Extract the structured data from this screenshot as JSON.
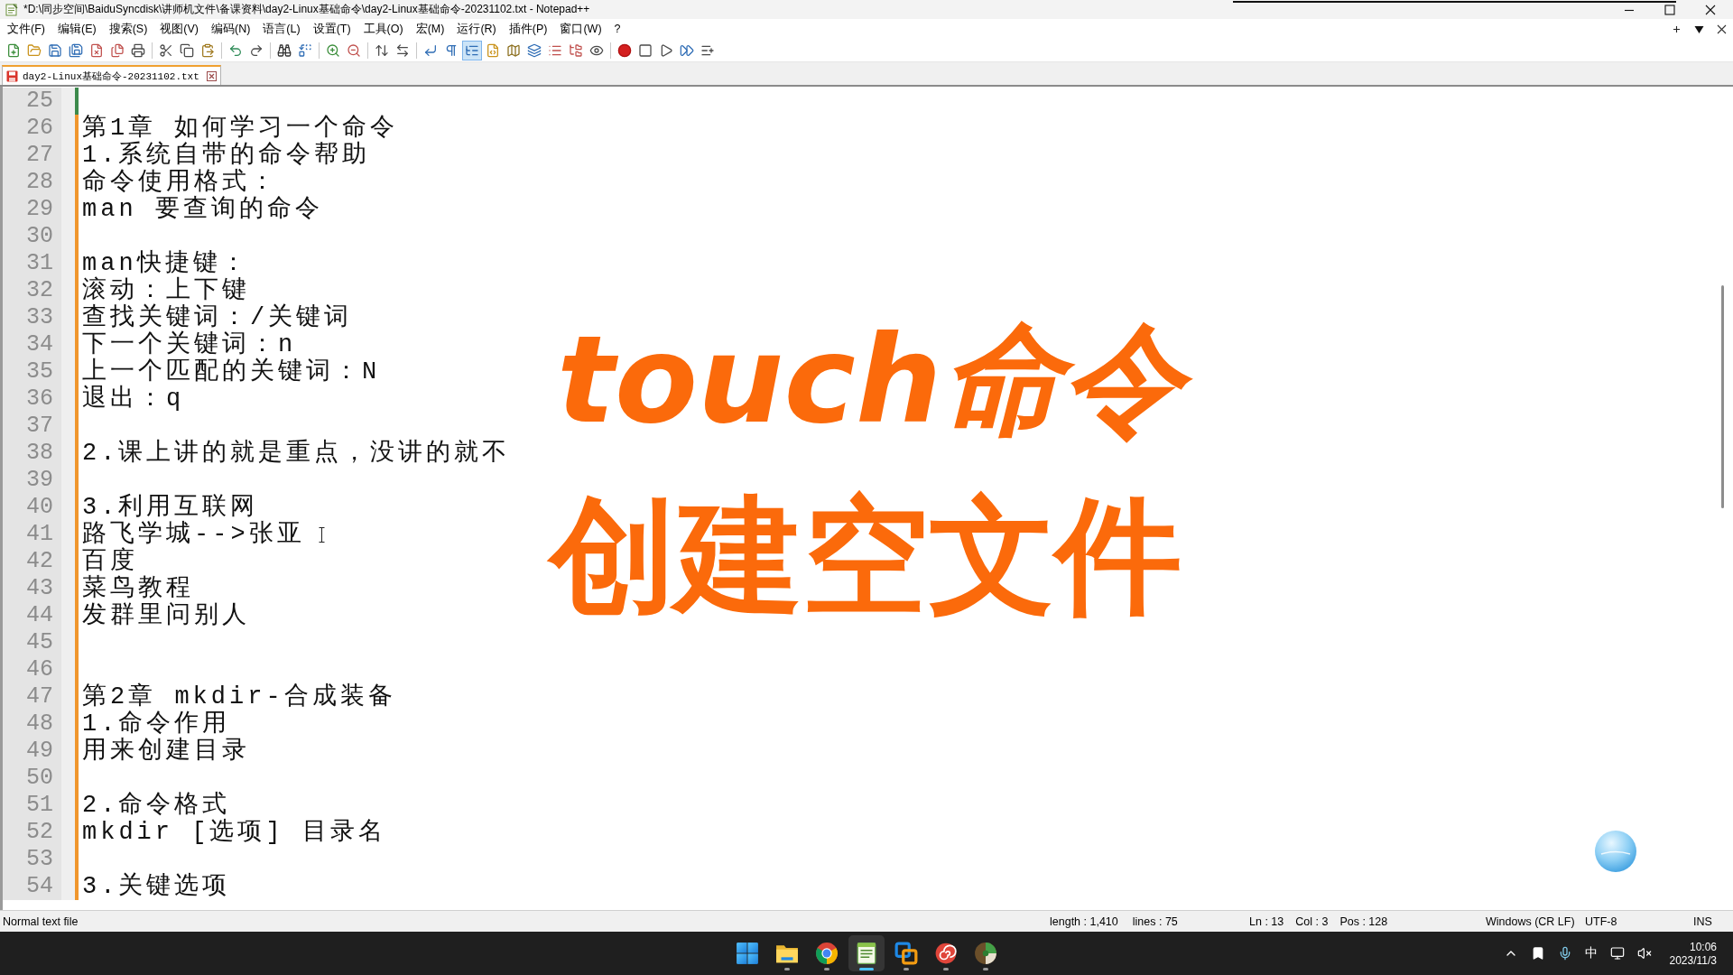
{
  "window": {
    "title": "*D:\\同步空间\\BaiduSyncdisk\\讲师机文件\\备课资料\\day2-Linux基础命令\\day2-Linux基础命令-20231102.txt - Notepad++"
  },
  "menu": [
    "文件(F)",
    "编辑(E)",
    "搜索(S)",
    "视图(V)",
    "编码(N)",
    "语言(L)",
    "设置(T)",
    "工具(O)",
    "宏(M)",
    "运行(R)",
    "插件(P)",
    "窗口(W)",
    "?"
  ],
  "toolbar": {
    "groups": [
      [
        {
          "kind": "new",
          "pressed": false
        },
        {
          "kind": "open",
          "pressed": false
        },
        {
          "kind": "save",
          "pressed": false
        },
        {
          "kind": "save_all",
          "pressed": false
        },
        {
          "kind": "close",
          "pressed": false
        },
        {
          "kind": "close_all",
          "pressed": false
        },
        {
          "kind": "print",
          "pressed": false
        }
      ],
      [
        {
          "kind": "cut",
          "pressed": false
        },
        {
          "kind": "copy",
          "pressed": false
        },
        {
          "kind": "paste",
          "pressed": false
        }
      ],
      [
        {
          "kind": "undo",
          "pressed": false
        },
        {
          "kind": "redo",
          "pressed": false
        }
      ],
      [
        {
          "kind": "find",
          "pressed": false
        },
        {
          "kind": "replace",
          "pressed": false
        }
      ],
      [
        {
          "kind": "zoom_in",
          "pressed": false
        },
        {
          "kind": "zoom_out",
          "pressed": false
        }
      ],
      [
        {
          "kind": "sync_vertical",
          "pressed": false
        },
        {
          "kind": "sync_horizontal",
          "pressed": false
        }
      ],
      [
        {
          "kind": "wrap",
          "pressed": false
        },
        {
          "kind": "all_chars",
          "pressed": false
        },
        {
          "kind": "indent_guide",
          "pressed": true
        },
        {
          "kind": "user_language",
          "pressed": false
        },
        {
          "kind": "document_map",
          "pressed": false
        },
        {
          "kind": "document_list",
          "pressed": false
        },
        {
          "kind": "function_list",
          "pressed": false
        },
        {
          "kind": "workspace",
          "pressed": false
        },
        {
          "kind": "monitoring",
          "pressed": false
        }
      ],
      [
        {
          "kind": "record",
          "pressed": false
        },
        {
          "kind": "stop",
          "pressed": false
        },
        {
          "kind": "play",
          "pressed": false
        },
        {
          "kind": "play_multiple",
          "pressed": false
        },
        {
          "kind": "save_macro",
          "pressed": false
        }
      ]
    ]
  },
  "tabs": [
    {
      "label": "day2-Linux基础命令-20231102.txt",
      "selected": true,
      "modified": true
    }
  ],
  "editor": {
    "lines": [
      {
        "number": "25",
        "color": "#3c8a4c"
      },
      {
        "number": "26",
        "text": "第1章 如何学习一个命令",
        "color": "#f0962d"
      },
      {
        "number": "27",
        "text": "1.系统自带的命令帮助",
        "color": "#f0962d"
      },
      {
        "number": "28",
        "text": "命令使用格式：",
        "color": "#f0962d"
      },
      {
        "number": "29",
        "text": "man 要查询的命令",
        "color": "#f0962d"
      },
      {
        "number": "30",
        "color": "#f0962d"
      },
      {
        "number": "31",
        "text": "man快捷键：",
        "color": "#f0962d"
      },
      {
        "number": "32",
        "text": "滚动：上下键",
        "color": "#f0962d"
      },
      {
        "number": "33",
        "text": "查找关键词：/关键词",
        "color": "#f0962d"
      },
      {
        "number": "34",
        "text": "下一个关键词：n",
        "color": "#f0962d"
      },
      {
        "number": "35",
        "text": "上一个匹配的关键词：N",
        "color": "#f0962d"
      },
      {
        "number": "36",
        "text": "退出：q",
        "color": "#f0962d"
      },
      {
        "number": "37",
        "color": "#f0962d"
      },
      {
        "number": "38",
        "text": "2.课上讲的就是重点，没讲的就不",
        "color": "#f0962d"
      },
      {
        "number": "39",
        "color": "#f0962d"
      },
      {
        "number": "40",
        "text": "3.利用互联网",
        "color": "#f0962d"
      },
      {
        "number": "41",
        "text": "路飞学城-->张亚",
        "color": "#f0962d"
      },
      {
        "number": "42",
        "text": "百度",
        "color": "#f0962d"
      },
      {
        "number": "43",
        "text": "菜鸟教程",
        "color": "#f0962d"
      },
      {
        "number": "44",
        "text": "发群里问别人",
        "color": "#f0962d"
      },
      {
        "number": "45",
        "color": "#f0962d"
      },
      {
        "number": "46",
        "color": "#f0962d"
      },
      {
        "number": "47",
        "text": "第2章 mkdir-合成装备",
        "color": "#f0962d"
      },
      {
        "number": "48",
        "text": "1.命令作用",
        "color": "#f0962d"
      },
      {
        "number": "49",
        "text": "用来创建目录",
        "color": "#f0962d"
      },
      {
        "number": "50",
        "color": "#f0962d"
      },
      {
        "number": "51",
        "text": "2.命令格式",
        "color": "#f0962d"
      },
      {
        "number": "52",
        "text": "mkdir [选项] 目录名",
        "color": "#f0962d"
      },
      {
        "number": "53",
        "color": "#f0962d"
      },
      {
        "number": "54",
        "text": "3.关键选项",
        "color": "#f0962d"
      }
    ]
  },
  "overlay_title": [
    "touch命令",
    "创建空文件"
  ],
  "status_bar": {
    "file_type": "Normal text file",
    "length": "length : 1,410",
    "lines": "lines : 75",
    "line": "Ln : 13",
    "column": "Col : 3",
    "position": "Pos : 128",
    "line_ending": "Windows (CR LF)",
    "encoding": "UTF-8",
    "mode": "INS"
  },
  "taskbar": {
    "apps": [
      {
        "kind": "folder",
        "running": true,
        "active": false
      },
      {
        "kind": "browser",
        "running": true,
        "active": false
      },
      {
        "kind": "notepad",
        "running": true,
        "active": true
      },
      {
        "kind": "squares",
        "running": true,
        "active": false
      },
      {
        "kind": "swirl",
        "running": true,
        "active": false
      },
      {
        "kind": "globe",
        "running": true,
        "active": false
      }
    ],
    "tray": {
      "input_method": "中",
      "time": "10:06",
      "date": "2023/11/3"
    }
  }
}
